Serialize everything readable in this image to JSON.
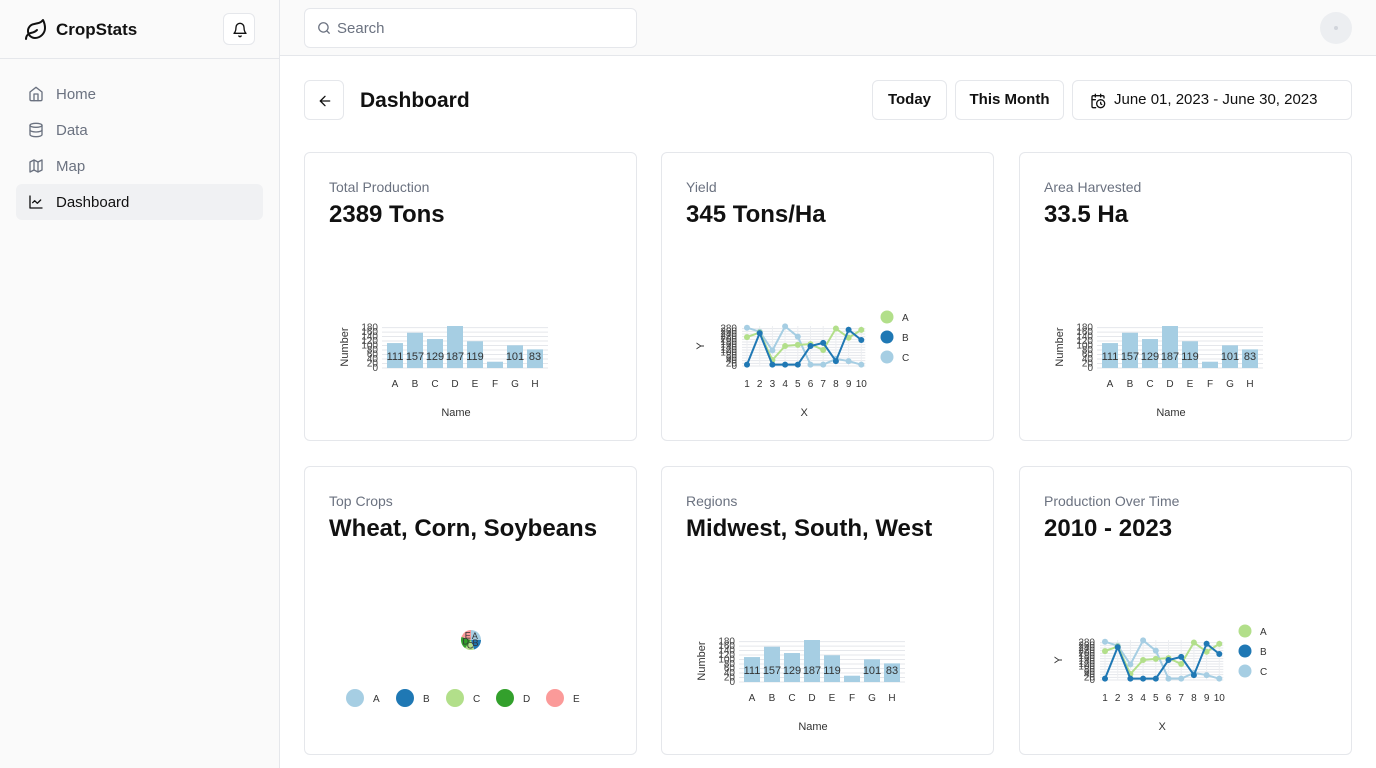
{
  "brand": {
    "name": "CropStats",
    "logo_icon": "leaf-icon"
  },
  "nav": {
    "items": [
      {
        "label": "Home",
        "icon": "home-icon",
        "active": false
      },
      {
        "label": "Data",
        "icon": "database-icon",
        "active": false
      },
      {
        "label": "Map",
        "icon": "map-icon",
        "active": false
      },
      {
        "label": "Dashboard",
        "icon": "line-chart-icon",
        "active": true
      }
    ]
  },
  "search": {
    "placeholder": "Search"
  },
  "header": {
    "title": "Dashboard",
    "today_label": "Today",
    "month_label": "This Month",
    "date_range": "June 01, 2023 - June 30, 2023"
  },
  "colors": {
    "lightblue": "#a6cee3",
    "darkblue": "#1f78b4",
    "lightgreen": "#b2df8a",
    "darkgreen": "#33a02c",
    "pink": "#fb9a99",
    "border": "#e5e7eb"
  },
  "cards": [
    {
      "label": "Total Production",
      "value": "2389 Tons"
    },
    {
      "label": "Yield",
      "value": "345 Tons/Ha"
    },
    {
      "label": "Area Harvested",
      "value": "33.5 Ha"
    },
    {
      "label": "Top Crops",
      "value": "Wheat, Corn, Soybeans"
    },
    {
      "label": "Regions",
      "value": "Midwest, South, West"
    },
    {
      "label": "Production Over Time",
      "value": "2010 - 2023"
    }
  ],
  "chart_data": [
    {
      "type": "bar",
      "categories": [
        "A",
        "B",
        "C",
        "D",
        "E",
        "F",
        "G",
        "H"
      ],
      "values": [
        111,
        157,
        129,
        187,
        119,
        28,
        101,
        83
      ],
      "xlabel": "Name",
      "ylabel": "Number",
      "yticks": [
        0,
        20,
        40,
        60,
        80,
        100,
        120,
        140,
        160,
        180
      ],
      "ylim": [
        0,
        187
      ]
    },
    {
      "type": "line",
      "x": [
        1,
        2,
        3,
        4,
        5,
        6,
        7,
        8,
        9,
        10
      ],
      "series": [
        {
          "name": "A",
          "values": [
            217,
            251,
            45,
            150,
            158,
            164,
            120,
            281,
            212,
            271
          ]
        },
        {
          "name": "B",
          "values": [
            10,
            247,
            10,
            10,
            10,
            150,
            173,
            37,
            272,
            195
          ]
        },
        {
          "name": "C",
          "values": [
            287,
            257,
            117,
            297,
            220,
            10,
            10,
            53,
            37,
            10
          ]
        }
      ],
      "xlabel": "X",
      "ylabel": "Y",
      "yticks": [
        0,
        20,
        40,
        60,
        80,
        100,
        120,
        140,
        160,
        180,
        200,
        220,
        240,
        260,
        280
      ],
      "ylim": [
        0,
        300
      ]
    },
    {
      "type": "bar",
      "categories": [
        "A",
        "B",
        "C",
        "D",
        "E",
        "F",
        "G",
        "H"
      ],
      "values": [
        111,
        157,
        129,
        187,
        119,
        28,
        101,
        83
      ],
      "xlabel": "Name",
      "ylabel": "Number",
      "yticks": [
        0,
        20,
        40,
        60,
        80,
        100,
        120,
        140,
        160,
        180
      ],
      "ylim": [
        0,
        187
      ]
    },
    {
      "type": "pie",
      "categories": [
        "A",
        "B",
        "C",
        "D",
        "E"
      ],
      "values": [
        25,
        20,
        15,
        20,
        20
      ]
    },
    {
      "type": "bar",
      "categories": [
        "A",
        "B",
        "C",
        "D",
        "E",
        "F",
        "G",
        "H"
      ],
      "values": [
        111,
        157,
        129,
        187,
        119,
        28,
        101,
        83
      ],
      "xlabel": "Name",
      "ylabel": "Number",
      "yticks": [
        0,
        20,
        40,
        60,
        80,
        100,
        120,
        140,
        160,
        180
      ],
      "ylim": [
        0,
        187
      ]
    },
    {
      "type": "line",
      "x": [
        1,
        2,
        3,
        4,
        5,
        6,
        7,
        8,
        9,
        10
      ],
      "series": [
        {
          "name": "A",
          "values": [
            217,
            251,
            45,
            150,
            158,
            164,
            120,
            281,
            212,
            271
          ]
        },
        {
          "name": "B",
          "values": [
            10,
            247,
            10,
            10,
            10,
            150,
            173,
            37,
            272,
            195
          ]
        },
        {
          "name": "C",
          "values": [
            287,
            257,
            117,
            297,
            220,
            10,
            10,
            53,
            37,
            10
          ]
        }
      ],
      "xlabel": "X",
      "ylabel": "Y",
      "yticks": [
        0,
        20,
        40,
        60,
        80,
        100,
        120,
        140,
        160,
        180,
        200,
        220,
        240,
        260,
        280
      ],
      "ylim": [
        0,
        300
      ]
    }
  ]
}
